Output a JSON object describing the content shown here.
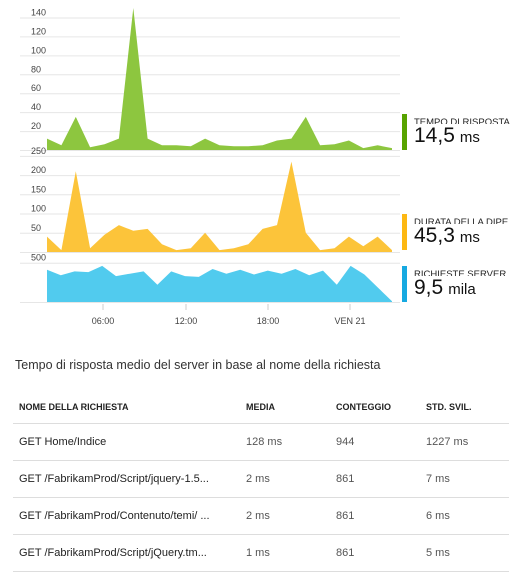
{
  "chart_data": [
    {
      "type": "area",
      "series": [
        {
          "name": "TEMPO DI RISPOSTA SE...",
          "color": "#8dc63f"
        }
      ],
      "yticks": [
        "140",
        "120",
        "100",
        "80",
        "60",
        "40",
        "20"
      ],
      "ylim": [
        0,
        150
      ],
      "values": [
        12,
        5,
        35,
        3,
        6,
        12,
        150,
        12,
        5,
        5,
        4,
        12,
        5,
        4,
        4,
        5,
        10,
        12,
        35,
        5,
        6,
        10,
        2,
        5,
        2
      ]
    },
    {
      "type": "area",
      "series": [
        {
          "name": "DURATA DELLA DIPEND...",
          "color": "#fcc43a"
        }
      ],
      "yticks": [
        "250",
        "200",
        "150",
        "100",
        "50"
      ],
      "ylim": [
        0,
        260
      ],
      "values": [
        40,
        5,
        210,
        10,
        45,
        70,
        55,
        60,
        20,
        5,
        10,
        50,
        5,
        10,
        20,
        60,
        70,
        235,
        50,
        5,
        10,
        40,
        15,
        40,
        5
      ]
    },
    {
      "type": "area",
      "series": [
        {
          "name": "RICHIESTE SERVER",
          "color": "#51cbee"
        }
      ],
      "yticks": [
        "500"
      ],
      "ylim": [
        0,
        560
      ],
      "values": [
        410,
        340,
        390,
        380,
        460,
        330,
        360,
        390,
        220,
        390,
        330,
        320,
        420,
        360,
        410,
        350,
        400,
        360,
        420,
        340,
        400,
        220,
        460,
        350,
        180,
        10
      ]
    }
  ],
  "x_ticks": [
    "06:00",
    "12:00",
    "18:00",
    "VEN 21"
  ],
  "legends": [
    {
      "label": "TEMPO DI RISPOSTA SE...",
      "value": "14,5",
      "unit": "ms",
      "color": "#57a300"
    },
    {
      "label": "DURATA DELLA DIPEND...",
      "value": "45,3",
      "unit": "ms",
      "color": "#fdb813"
    },
    {
      "label": "RICHIESTE SERVER",
      "value": "9,5",
      "unit": "mila",
      "color": "#16a9e1"
    }
  ],
  "table": {
    "title": "Tempo di risposta medio del server in base al nome della richiesta",
    "headers": [
      "NOME DELLA RICHIESTA",
      "MEDIA",
      "CONTEGGIO",
      "STD. SVIL."
    ],
    "rows": [
      [
        "GET Home/Indice",
        "128 ms",
        "944",
        "1227 ms"
      ],
      [
        "GET /FabrikamProd/Script/jquery-1.5...",
        "2 ms",
        "861",
        "7 ms"
      ],
      [
        "GET /FabrikamProd/Contenuto/temi/ ...",
        "2 ms",
        "861",
        "6 ms"
      ],
      [
        "GET /FabrikamProd/Script/jQuery.tm...",
        "1 ms",
        "861",
        "5 ms"
      ]
    ]
  }
}
